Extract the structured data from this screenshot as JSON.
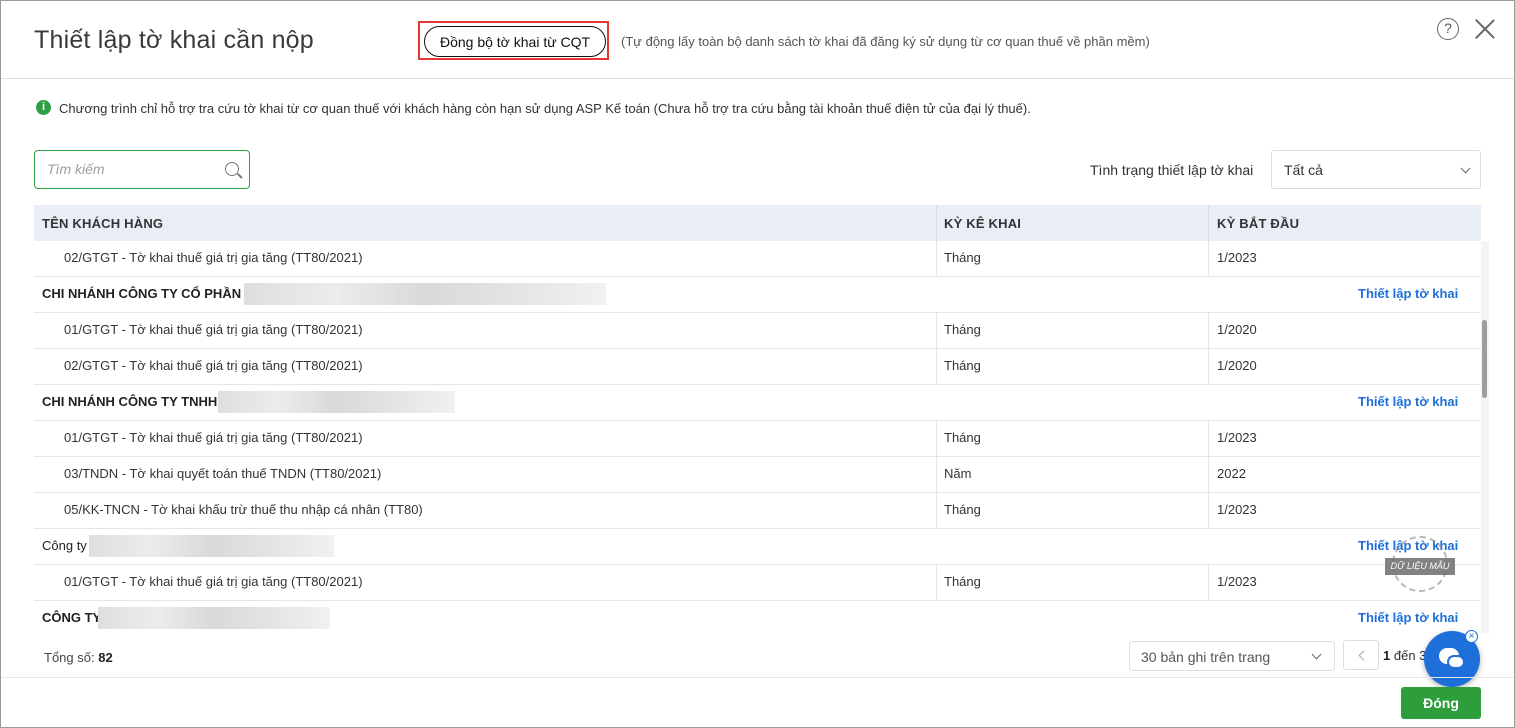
{
  "dialog": {
    "title": "Thiết lập tờ khai cần nộp",
    "sync_button": "Đồng bộ tờ khai từ CQT",
    "sync_note": "(Tự động lấy toàn bộ danh sách tờ khai đã đăng ký sử dụng từ cơ quan thuế về phần mềm)",
    "help_glyph": "?",
    "info_text": "Chương trình chỉ hỗ trợ tra cứu tờ khai từ cơ quan thuế với khách hàng còn hạn sử dụng ASP Kế toán (Chưa hỗ trợ tra cứu bằng tài khoản thuế điện tử của đại lý thuế)."
  },
  "search": {
    "placeholder": "Tìm kiếm",
    "value": ""
  },
  "filter": {
    "label": "Tình trạng thiết lập tờ khai",
    "selected": "Tất cả"
  },
  "table": {
    "headers": [
      "TÊN KHÁCH HÀNG",
      "KỲ KÊ KHAI",
      "KỲ BẮT ĐẦU"
    ],
    "setup_link": "Thiết lập tờ khai",
    "rows": [
      {
        "name": "02/GTGT - Tờ khai thuế giá trị gia tăng (TT80/2021)",
        "period": "Tháng",
        "start": "1/2023"
      },
      {
        "group": "CHI NHÁNH CÔNG TY CỔ PHẦN"
      },
      {
        "name": "01/GTGT - Tờ khai thuế giá trị gia tăng (TT80/2021)",
        "period": "Tháng",
        "start": "1/2020"
      },
      {
        "name": "02/GTGT - Tờ khai thuế giá trị gia tăng (TT80/2021)",
        "period": "Tháng",
        "start": "1/2020"
      },
      {
        "group": "CHI NHÁNH CÔNG TY TNHH"
      },
      {
        "name": "01/GTGT - Tờ khai thuế giá trị gia tăng (TT80/2021)",
        "period": "Tháng",
        "start": "1/2023"
      },
      {
        "name": "03/TNDN - Tờ khai quyết toán thuế TNDN (TT80/2021)",
        "period": "Năm",
        "start": "2022"
      },
      {
        "name": "05/KK-TNCN - Tờ khai khấu trừ thuế thu nhập cá nhân (TT80)",
        "period": "Tháng",
        "start": "1/2023"
      },
      {
        "group": "Công ty"
      },
      {
        "name": "01/GTGT - Tờ khai thuế giá trị gia tăng (TT80/2021)",
        "period": "Tháng",
        "start": "1/2023"
      },
      {
        "group": "CÔNG TY"
      }
    ]
  },
  "footer": {
    "total_label": "Tổng số:",
    "total_value": "82",
    "page_size": "30 bản ghi trên trang",
    "page_from": "1",
    "page_to_label": "đến 3",
    "close_button": "Đóng"
  },
  "watermark": {
    "text": "DỮ LIỆU MẪU"
  },
  "chat": {
    "close_glyph": "×"
  },
  "colors": {
    "accent_green": "#2e9d3c",
    "link_blue": "#1e6fd9",
    "highlight_red": "#e53935",
    "header_bg": "#e9eef6"
  }
}
